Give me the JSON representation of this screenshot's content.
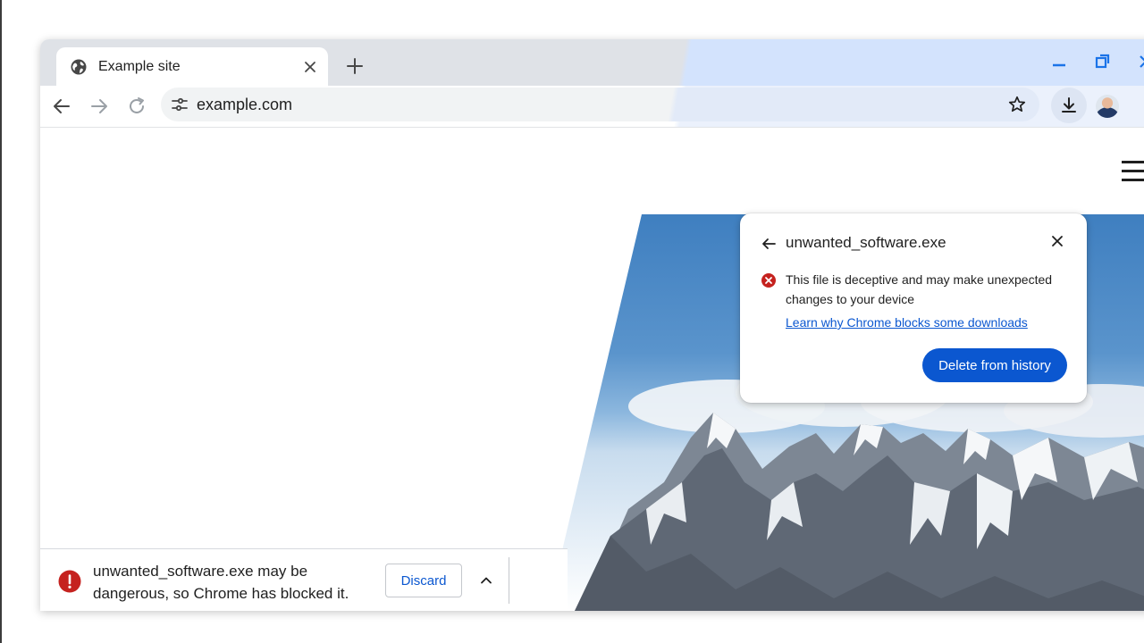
{
  "colors": {
    "accent": "#0b57d0",
    "danger": "#c5221f",
    "tabstrip": "#dfe2e7",
    "tabstrip_active_region": "#d3e3fd"
  },
  "tab": {
    "title": "Example site",
    "icon": "globe-icon",
    "close_icon": "close-icon"
  },
  "toolbar": {
    "url": "example.com",
    "icons": [
      "back-arrow-icon",
      "forward-arrow-icon",
      "reload-icon",
      "site-settings-icon",
      "star-icon",
      "download-icon"
    ]
  },
  "download_bubble": {
    "filename": "unwanted_software.exe",
    "message": "This file is deceptive and may make unexpected changes to your device",
    "learn_link": "Learn why Chrome blocks some downloads",
    "delete_button": "Delete from history"
  },
  "download_shelf": {
    "message": "unwanted_software.exe may be dangerous, so Chrome has blocked it.",
    "discard_button": "Discard"
  }
}
